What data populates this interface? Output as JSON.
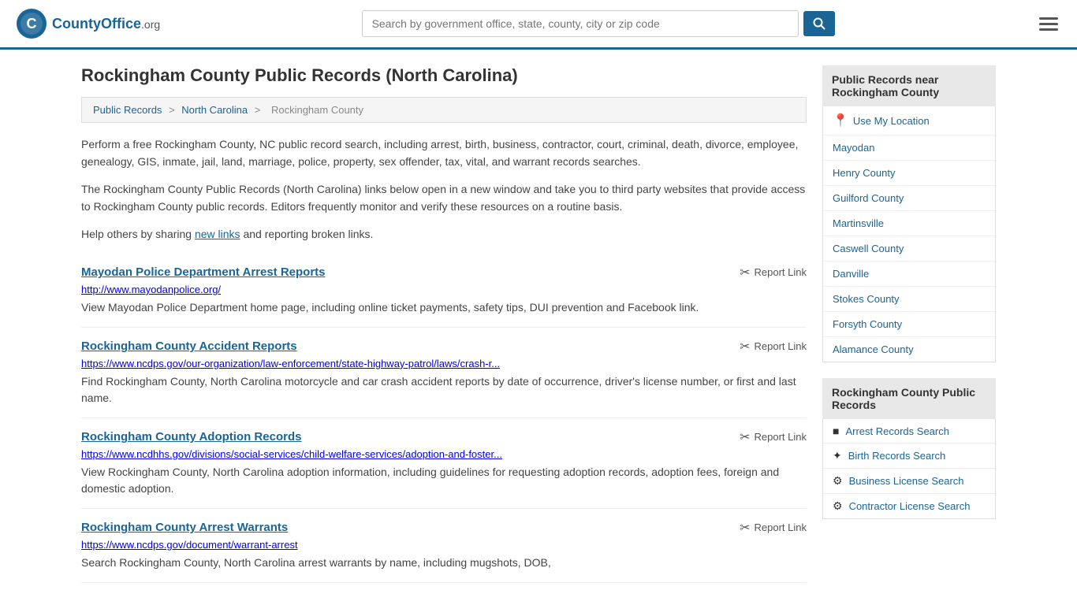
{
  "header": {
    "logo_text": "CountyOffice",
    "logo_suffix": ".org",
    "search_placeholder": "Search by government office, state, county, city or zip code",
    "search_value": ""
  },
  "page": {
    "title": "Rockingham County Public Records (North Carolina)"
  },
  "breadcrumb": {
    "items": [
      "Public Records",
      "North Carolina",
      "Rockingham County"
    ]
  },
  "description": {
    "para1": "Perform a free Rockingham County, NC public record search, including arrest, birth, business, contractor, court, criminal, death, divorce, employee, genealogy, GIS, inmate, jail, land, marriage, police, property, sex offender, tax, vital, and warrant records searches.",
    "para2": "The Rockingham County Public Records (North Carolina) links below open in a new window and take you to third party websites that provide access to Rockingham County public records. Editors frequently monitor and verify these resources on a routine basis.",
    "para3_before": "Help others by sharing ",
    "para3_link": "new links",
    "para3_after": " and reporting broken links."
  },
  "records": [
    {
      "title": "Mayodan Police Department Arrest Reports",
      "url": "http://www.mayodanpolice.org/",
      "desc": "View Mayodan Police Department home page, including online ticket payments, safety tips, DUI prevention and Facebook link."
    },
    {
      "title": "Rockingham County Accident Reports",
      "url": "https://www.ncdps.gov/our-organization/law-enforcement/state-highway-patrol/laws/crash-r...",
      "desc": "Find Rockingham County, North Carolina motorcycle and car crash accident reports by date of occurrence, driver's license number, or first and last name."
    },
    {
      "title": "Rockingham County Adoption Records",
      "url": "https://www.ncdhhs.gov/divisions/social-services/child-welfare-services/adoption-and-foster...",
      "desc": "View Rockingham County, North Carolina adoption information, including guidelines for requesting adoption records, adoption fees, foreign and domestic adoption."
    },
    {
      "title": "Rockingham County Arrest Warrants",
      "url": "https://www.ncdps.gov/document/warrant-arrest",
      "desc": "Search Rockingham County, North Carolina arrest warrants by name, including mugshots, DOB,"
    }
  ],
  "report_link_label": "Report Link",
  "sidebar": {
    "nearby_header": "Public Records near Rockingham County",
    "use_my_location": "Use My Location",
    "nearby_places": [
      "Mayodan",
      "Henry County",
      "Guilford County",
      "Martinsville",
      "Caswell County",
      "Danville",
      "Stokes County",
      "Forsyth County",
      "Alamance County"
    ],
    "records_header": "Rockingham County Public Records",
    "records_links": [
      {
        "icon": "■",
        "label": "Arrest Records Search"
      },
      {
        "icon": "✦",
        "label": "Birth Records Search"
      },
      {
        "icon": "⚙",
        "label": "Business License Search"
      },
      {
        "icon": "⚙",
        "label": "Contractor License Search"
      }
    ]
  }
}
